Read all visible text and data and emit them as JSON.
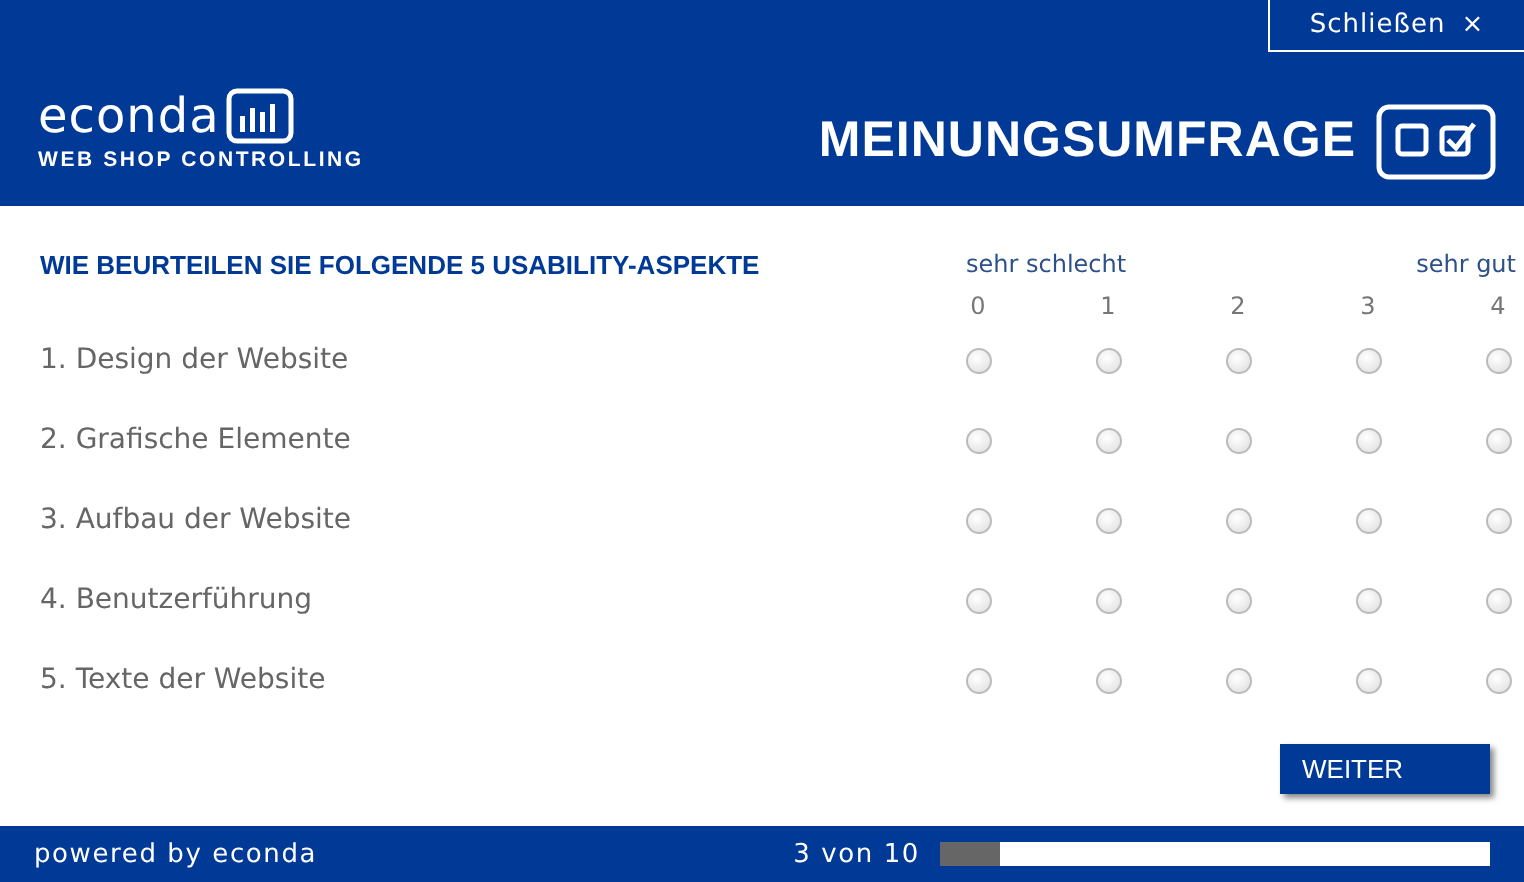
{
  "close_button": {
    "label": "Schließen",
    "icon": "×"
  },
  "logo": {
    "name": "econda",
    "tagline": "WEB SHOP CONTROLLING"
  },
  "title": "MEINUNGSUMFRAGE",
  "question": "WIE BEURTEILEN SIE FOLGENDE 5 USABILITY-ASPEKTE",
  "scale": {
    "low_label": "sehr schlecht",
    "high_label": "sehr gut",
    "values": [
      "0",
      "1",
      "2",
      "3",
      "4"
    ]
  },
  "items": [
    {
      "number": "1.",
      "label": "Design der Website",
      "options": [
        {
          "selected": false
        },
        {
          "selected": false
        },
        {
          "selected": false
        },
        {
          "selected": false
        },
        {
          "selected": false
        }
      ]
    },
    {
      "number": "2.",
      "label": "Grafische Elemente",
      "options": [
        {
          "selected": false
        },
        {
          "selected": false
        },
        {
          "selected": false
        },
        {
          "selected": false
        },
        {
          "selected": false
        }
      ]
    },
    {
      "number": "3.",
      "label": "Aufbau der Website",
      "options": [
        {
          "selected": false
        },
        {
          "selected": false
        },
        {
          "selected": false
        },
        {
          "selected": false
        },
        {
          "selected": false
        }
      ]
    },
    {
      "number": "4.",
      "label": "Benutzerführung",
      "options": [
        {
          "selected": false
        },
        {
          "selected": false
        },
        {
          "selected": false
        },
        {
          "selected": false
        },
        {
          "selected": false
        }
      ]
    },
    {
      "number": "5.",
      "label": "Texte der Website",
      "options": [
        {
          "selected": false
        },
        {
          "selected": false
        },
        {
          "selected": false
        },
        {
          "selected": false
        },
        {
          "selected": false
        }
      ]
    }
  ],
  "next_button": "WEITER",
  "footer": {
    "powered_by": "powered by econda",
    "page_count": "3 von 10",
    "progress": {
      "level": 0.11
    }
  }
}
